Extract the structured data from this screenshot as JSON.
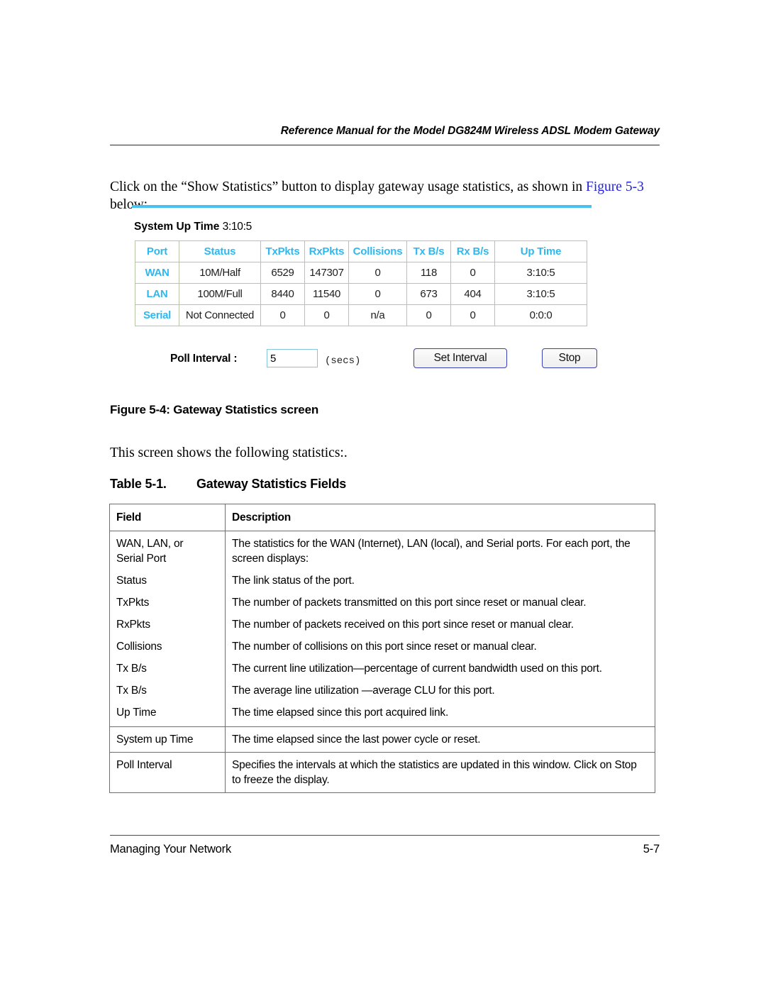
{
  "header": {
    "running_title": "Reference Manual for the Model DG824M Wireless ADSL Modem Gateway"
  },
  "body": {
    "paragraph_before_xref": "Click on the “Show Statistics” button to display gateway usage statistics, as shown in ",
    "xref_label": "Figure 5-3",
    "paragraph_after_xref": " below:"
  },
  "figure": {
    "caption": "Figure 5-4: Gateway Statistics screen",
    "system_up_time_label": "System Up Time",
    "system_up_time_value": "3:10:5",
    "stats_table": {
      "columns": [
        "Port",
        "Status",
        "TxPkts",
        "RxPkts",
        "Collisions",
        "Tx B/s",
        "Rx B/s",
        "Up Time"
      ],
      "rows": [
        {
          "port": "WAN",
          "status": "10M/Half",
          "txpkts": "6529",
          "rxpkts": "147307",
          "collisions": "0",
          "txbs": "118",
          "rxbs": "0",
          "uptime": "3:10:5"
        },
        {
          "port": "LAN",
          "status": "100M/Full",
          "txpkts": "8440",
          "rxpkts": "11540",
          "collisions": "0",
          "txbs": "673",
          "rxbs": "404",
          "uptime": "3:10:5"
        },
        {
          "port": "Serial",
          "status": "Not Connected",
          "txpkts": "0",
          "rxpkts": "0",
          "collisions": "n/a",
          "txbs": "0",
          "rxbs": "0",
          "uptime": "0:0:0"
        }
      ]
    },
    "poll": {
      "label": "Poll Interval :",
      "value": "5",
      "units": "(secs)",
      "set_button": "Set Interval",
      "stop_button": "Stop"
    },
    "colors": {
      "accent_rule": "#45c2f0",
      "table_header_text": "#2fb8ef",
      "table_border": "#b9c4a4",
      "button_border": "#3a40b8",
      "input_border": "#84c4dd"
    }
  },
  "lead_in": "This screen shows the following statistics:.",
  "table_title": {
    "number": "Table 5-1.",
    "name": "Gateway Statistics Fields"
  },
  "fields_table": {
    "headers": [
      "Field",
      "Description"
    ],
    "rows": [
      {
        "field_line1": "WAN, LAN, or",
        "field_line2": "Serial Port",
        "description": "The statistics for the WAN (Internet), LAN (local), and Serial ports. For each port, the screen displays:"
      },
      {
        "field": "Status",
        "description": "The link status of the port."
      },
      {
        "field": "TxPkts",
        "description": "The number of packets transmitted on this port since reset or manual clear."
      },
      {
        "field": "RxPkts",
        "description": "The number of packets received on this port since reset or manual clear."
      },
      {
        "field": "Collisions",
        "description": "The number of collisions on this port since reset or manual clear."
      },
      {
        "field": "Tx B/s",
        "description": "The current line utilization—percentage of current bandwidth used on this port."
      },
      {
        "field": "Tx B/s",
        "description": "The average line utilization —average CLU for this port."
      },
      {
        "field": "Up Time",
        "description": "The time elapsed since this port acquired link."
      },
      {
        "field": "System up Time",
        "description": "The time elapsed since the last power cycle or reset."
      },
      {
        "field": "Poll Interval",
        "description": "Specifies the intervals at which the statistics are updated in this window. Click on Stop to freeze the display."
      }
    ]
  },
  "footer": {
    "section": "Managing Your Network",
    "page_number": "5-7"
  }
}
